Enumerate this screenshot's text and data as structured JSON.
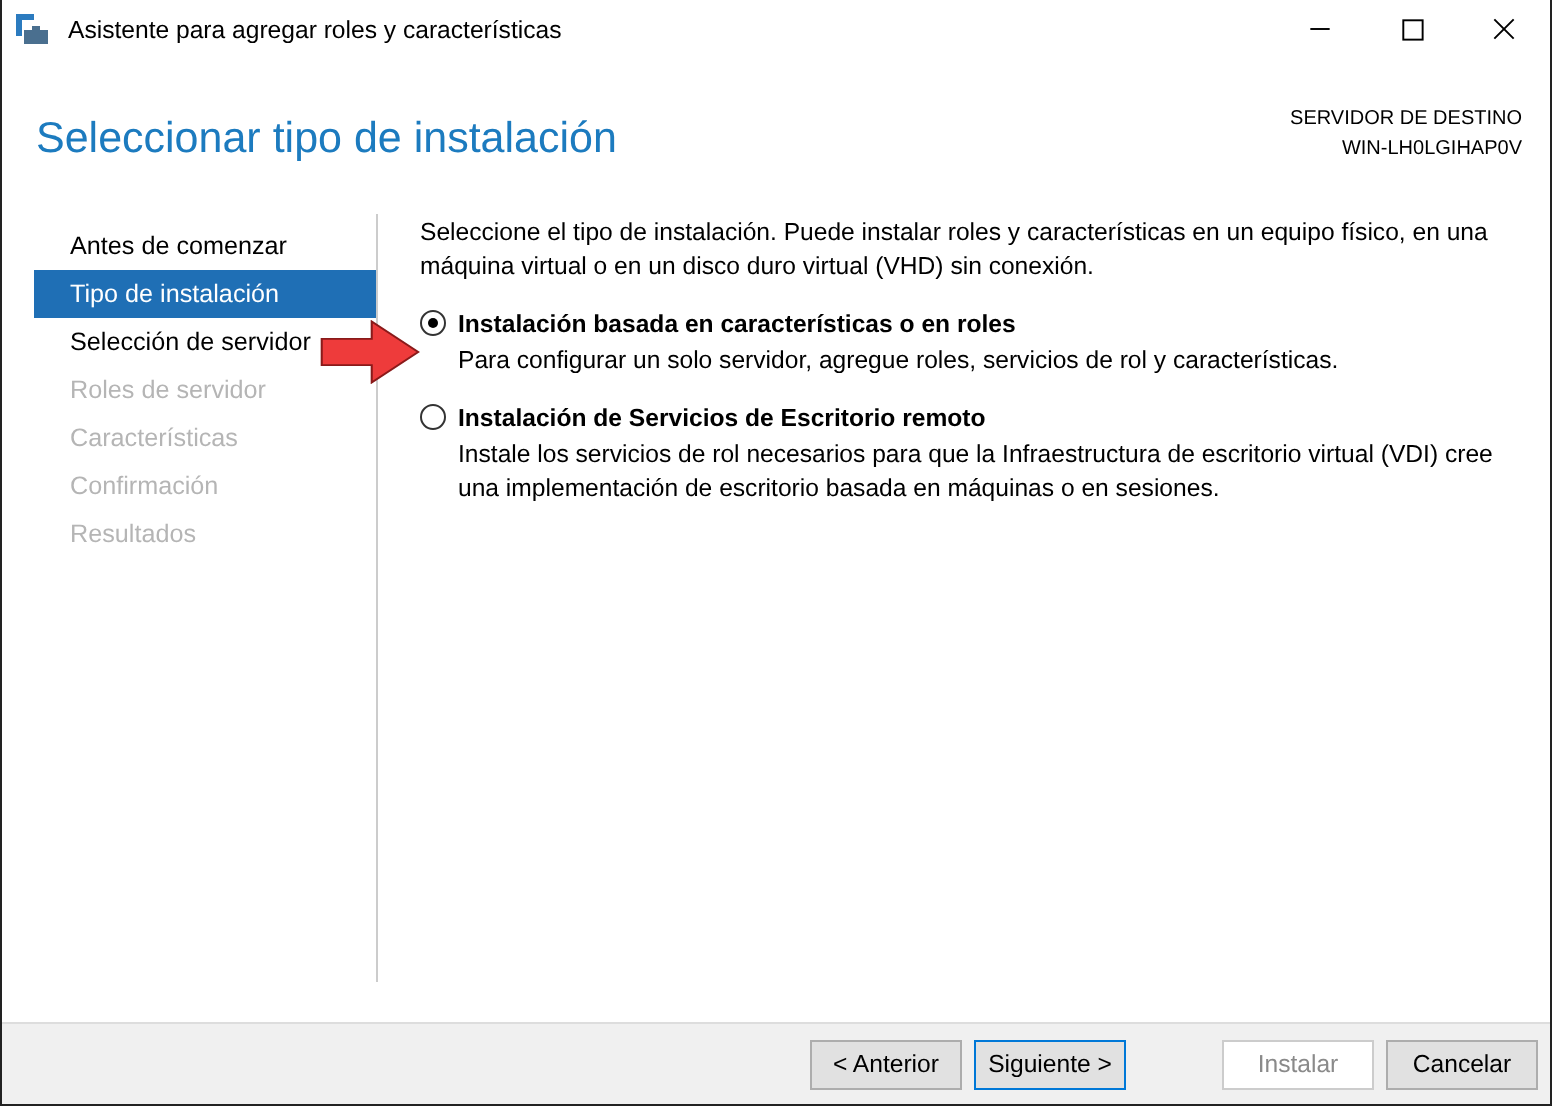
{
  "window": {
    "title": "Asistente para agregar roles y características"
  },
  "header": {
    "title": "Seleccionar tipo de instalación",
    "server_label": "SERVIDOR DE DESTINO",
    "server_name": "WIN-LH0LGIHAP0V"
  },
  "sidebar": {
    "items": [
      {
        "label": "Antes de comenzar",
        "selected": false,
        "disabled": false
      },
      {
        "label": "Tipo de instalación",
        "selected": true,
        "disabled": false
      },
      {
        "label": "Selección de servidor",
        "selected": false,
        "disabled": false
      },
      {
        "label": "Roles de servidor",
        "selected": false,
        "disabled": true
      },
      {
        "label": "Características",
        "selected": false,
        "disabled": true
      },
      {
        "label": "Confirmación",
        "selected": false,
        "disabled": true
      },
      {
        "label": "Resultados",
        "selected": false,
        "disabled": true
      }
    ]
  },
  "content": {
    "intro": "Seleccione el tipo de instalación. Puede instalar roles y características en un equipo físico, en una máquina virtual o en un disco duro virtual (VHD) sin conexión.",
    "options": [
      {
        "label": "Instalación basada en características o en roles",
        "description": "Para configurar un solo servidor, agregue roles, servicios de rol y características.",
        "selected": true
      },
      {
        "label": "Instalación de Servicios de Escritorio remoto",
        "description": "Instale los servicios de rol necesarios para que la Infraestructura de escritorio virtual (VDI) cree una implementación de escritorio basada en máquinas o en sesiones.",
        "selected": false
      }
    ]
  },
  "buttons": [
    {
      "label": "< Anterior",
      "default": false,
      "disabled": false
    },
    {
      "label": "Siguiente >",
      "default": true,
      "disabled": false
    },
    {
      "label": "Instalar",
      "default": false,
      "disabled": true
    },
    {
      "label": "Cancelar",
      "default": false,
      "disabled": false
    }
  ]
}
